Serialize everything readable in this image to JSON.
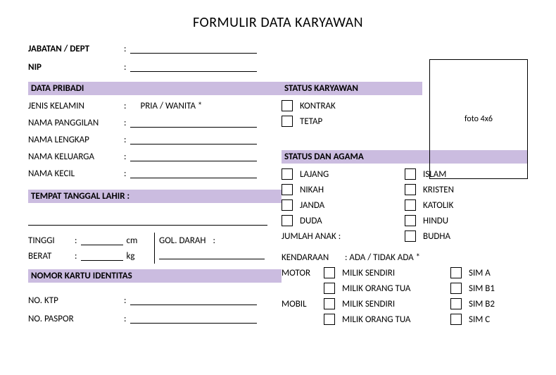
{
  "title": "FORMULIR DATA KARYAWAN",
  "top": {
    "jabatan_label": "JABATAN / DEPT",
    "nip_label": "NIP"
  },
  "sections": {
    "data_pribadi": "DATA PRIBADI",
    "tempat_lahir": "TEMPAT TANGGAL LAHIR :",
    "nomor_identitas": "NOMOR KARTU IDENTITAS",
    "status_karyawan": "STATUS KARYAWAN",
    "status_agama": "STATUS DAN AGAMA"
  },
  "pribadi": {
    "jenis_kelamin_label": "JENIS KELAMIN",
    "jenis_kelamin_value": "PRIA / WANITA *",
    "nama_panggilan_label": "NAMA PANGGILAN",
    "nama_lengkap_label": "NAMA LENGKAP",
    "nama_keluarga_label": "NAMA KELUARGA",
    "nama_kecil_label": "NAMA KECIL"
  },
  "fisik": {
    "tinggi_label": "TINGGI",
    "tinggi_unit": "cm",
    "berat_label": "BERAT",
    "berat_unit": "kg",
    "gol_darah_label": "GOL. DARAH"
  },
  "identitas": {
    "ktp_label": "NO. KTP",
    "paspor_label": "NO. PASPOR"
  },
  "photo": {
    "label": "foto 4x6"
  },
  "status_karyawan_opts": {
    "kontrak": "KONTRAK",
    "tetap": "TETAP"
  },
  "status_opts": {
    "lajang": "LAJANG",
    "nikah": "NIKAH",
    "janda": "JANDA",
    "duda": "DUDA"
  },
  "agama_opts": {
    "islam": "ISLAM",
    "kristen": "KRISTEN",
    "katolik": "KATOLIK",
    "hindu": "HINDU",
    "budha": "BUDHA"
  },
  "jumlah_anak_label": "JUMLAH ANAK :",
  "kendaraan": {
    "label": "KENDARAAN",
    "value": ": ADA / TIDAK ADA *",
    "motor_label": "MOTOR",
    "mobil_label": "MOBIL",
    "milik_sendiri": "MILIK SENDIRI",
    "milik_ortu": "MILIK ORANG TUA",
    "sim_a": "SIM A",
    "sim_b1": "SIM B1",
    "sim_b2": "SIM B2",
    "sim_c": "SIM C"
  }
}
